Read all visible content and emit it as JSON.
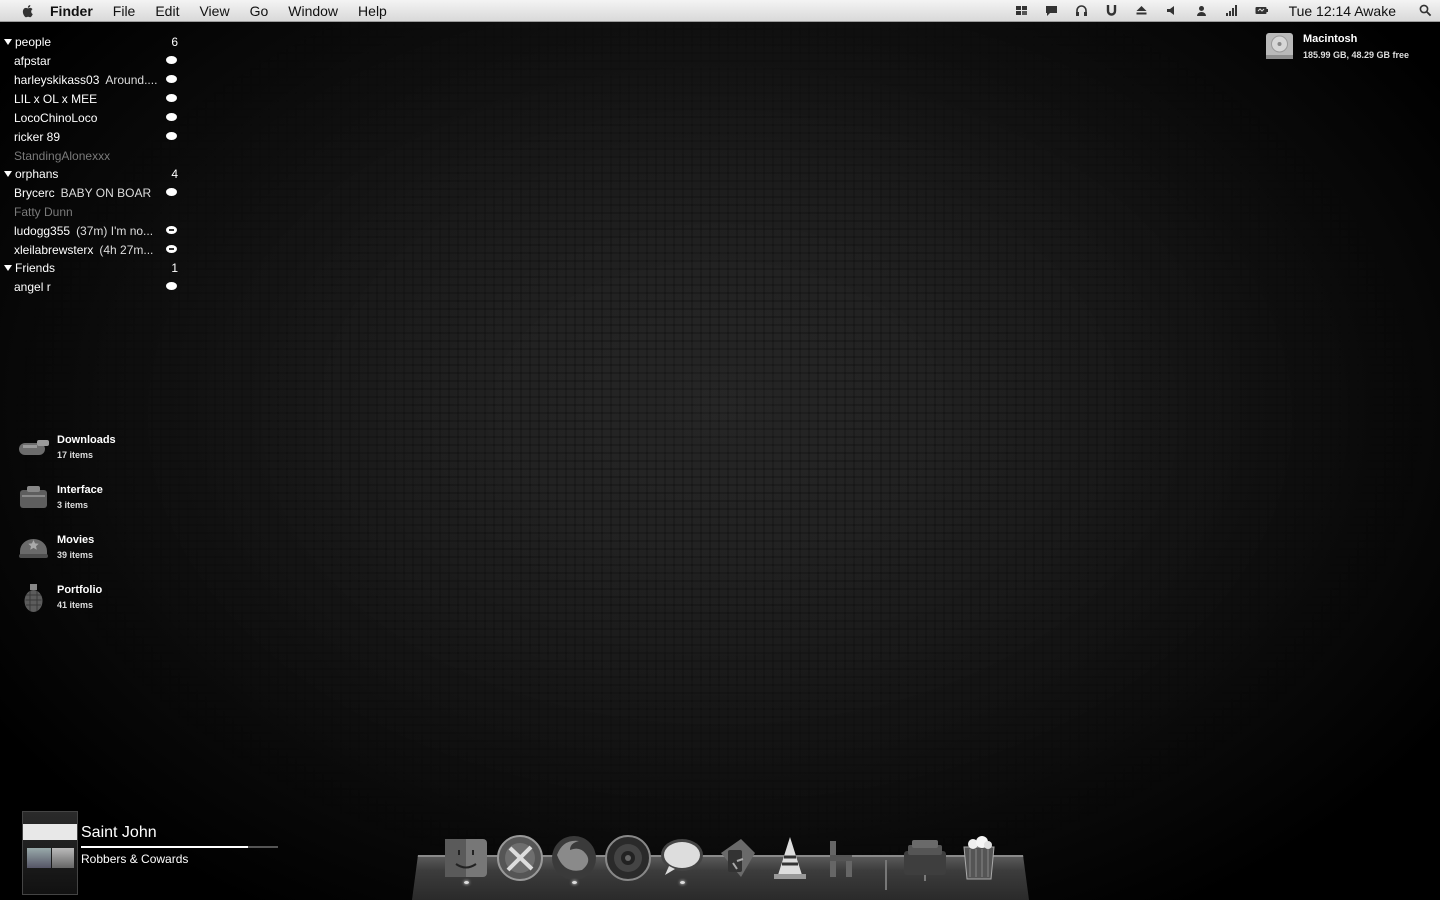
{
  "menubar": {
    "app_name": "Finder",
    "menus": [
      "File",
      "Edit",
      "View",
      "Go",
      "Window",
      "Help"
    ],
    "status_icons": [
      "screens-icon",
      "chat-icon",
      "headphones-icon",
      "magnet-icon",
      "eject-icon",
      "volume-icon",
      "user-icon",
      "signal-icon",
      "battery-icon"
    ],
    "clock": "Tue 12:14",
    "clock_extra": "Awake"
  },
  "buddy_list": {
    "groups": [
      {
        "name": "people",
        "count": "6",
        "buddies": [
          {
            "name": "afpstar",
            "status": "",
            "state": "available"
          },
          {
            "name": "harleyskikass03",
            "status": "Around....",
            "state": "available"
          },
          {
            "name": "LIL x OL x MEE",
            "status": "",
            "state": "available"
          },
          {
            "name": "LocoChinoLoco",
            "status": "",
            "state": "available"
          },
          {
            "name": "ricker 89",
            "status": "",
            "state": "available"
          },
          {
            "name": "StandingAlonexxx",
            "status": "",
            "state": "offline"
          }
        ]
      },
      {
        "name": "orphans",
        "count": "4",
        "buddies": [
          {
            "name": "Brycerc",
            "status": "BABY ON BOAR",
            "state": "available"
          },
          {
            "name": "Fatty Dunn",
            "status": "",
            "state": "offline"
          },
          {
            "name": "ludogg355",
            "status": "(37m) I'm no...",
            "state": "away"
          },
          {
            "name": "xleilabrewsterx",
            "status": "(4h 27m...",
            "state": "away"
          }
        ]
      },
      {
        "name": "Friends",
        "count": "1",
        "buddies": [
          {
            "name": "angel r",
            "status": "",
            "state": "available"
          }
        ]
      }
    ]
  },
  "stacks": [
    {
      "name": "Downloads",
      "count": "17 items",
      "icon": "downloads-folder-icon"
    },
    {
      "name": "Interface",
      "count": "3 items",
      "icon": "interface-folder-icon"
    },
    {
      "name": "Movies",
      "count": "39 items",
      "icon": "movies-folder-icon"
    },
    {
      "name": "Portfolio",
      "count": "41 items",
      "icon": "portfolio-folder-icon"
    }
  ],
  "disk": {
    "name": "Macintosh",
    "info": "185.99 GB, 48.29 GB free"
  },
  "now_playing": {
    "track": "Saint John",
    "artist": "Robbers & Cowards",
    "progress": 0.85
  },
  "dock": {
    "items": [
      "finder-icon",
      "xcode-icon",
      "firefox-icon",
      "itunes-icon",
      "messages-icon",
      "adium-icon",
      "vlc-icon",
      "coda-icon",
      "stack-icon",
      "trash-icon"
    ],
    "running": [
      "finder-icon",
      "firefox-icon",
      "messages-icon"
    ]
  }
}
